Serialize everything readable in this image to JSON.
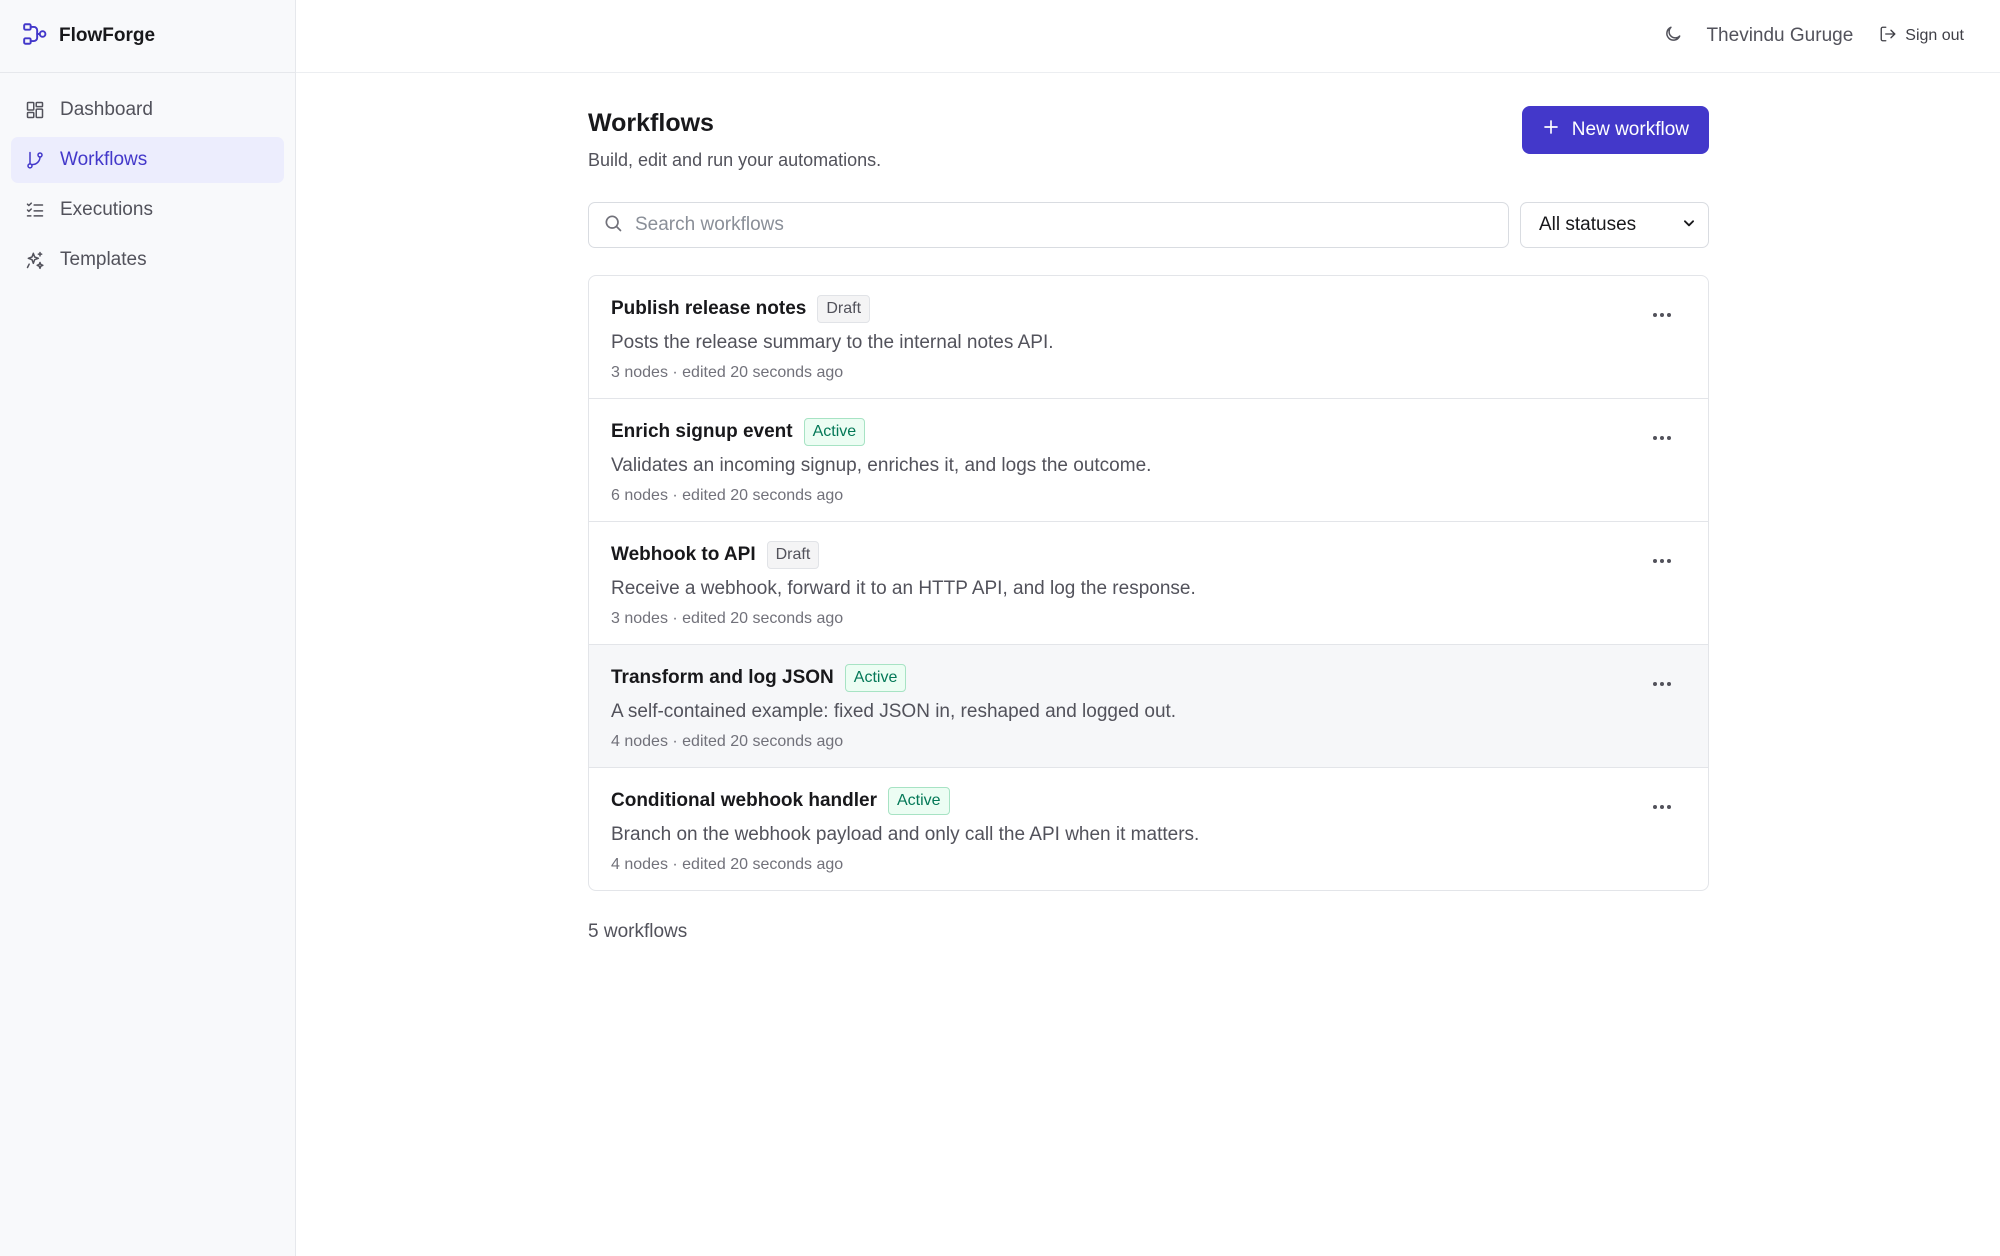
{
  "app": {
    "name": "FlowForge"
  },
  "sidebar": {
    "items": [
      {
        "label": "Dashboard",
        "icon": "dashboard-icon",
        "active": false
      },
      {
        "label": "Workflows",
        "icon": "workflow-branch-icon",
        "active": true
      },
      {
        "label": "Executions",
        "icon": "list-checks-icon",
        "active": false
      },
      {
        "label": "Templates",
        "icon": "sparkles-icon",
        "active": false
      }
    ]
  },
  "topbar": {
    "theme_icon": "moon-icon",
    "user_name": "Thevindu Guruge",
    "signout_label": "Sign out"
  },
  "page": {
    "title": "Workflows",
    "subtitle": "Build, edit and run your automations.",
    "new_button_label": "New workflow"
  },
  "filters": {
    "search_placeholder": "Search workflows",
    "status_selected": "All statuses"
  },
  "workflows": [
    {
      "name": "Publish release notes",
      "status": "Draft",
      "description": "Posts the release summary to the internal notes API.",
      "meta": "3 nodes · edited 20 seconds ago"
    },
    {
      "name": "Enrich signup event",
      "status": "Active",
      "description": "Validates an incoming signup, enriches it, and logs the outcome.",
      "meta": "6 nodes · edited 20 seconds ago"
    },
    {
      "name": "Webhook to API",
      "status": "Draft",
      "description": "Receive a webhook, forward it to an HTTP API, and log the response.",
      "meta": "3 nodes · edited 20 seconds ago"
    },
    {
      "name": "Transform and log JSON",
      "status": "Active",
      "description": "A self-contained example: fixed JSON in, reshaped and logged out.",
      "meta": "4 nodes · edited 20 seconds ago"
    },
    {
      "name": "Conditional webhook handler",
      "status": "Active",
      "description": "Branch on the webhook payload and only call the API when it matters.",
      "meta": "4 nodes · edited 20 seconds ago"
    }
  ],
  "footer": {
    "count_label": "5 workflows"
  },
  "colors": {
    "accent": "#4338ca",
    "active_badge": "#047857",
    "sidebar_bg": "#f8f9fb"
  }
}
